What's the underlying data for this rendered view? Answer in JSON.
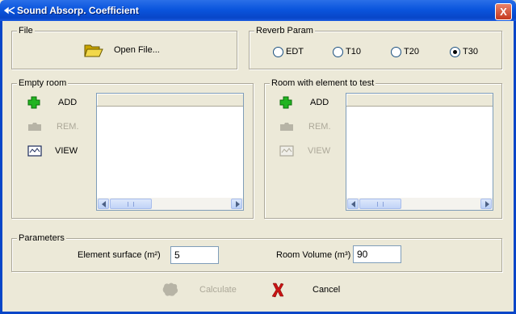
{
  "window": {
    "title": "Sound Absorp. Coefficient",
    "close_label": "X"
  },
  "file_group": {
    "label": "File",
    "open_label": "Open File..."
  },
  "reverb": {
    "label": "Reverb Param",
    "options": [
      {
        "label": "EDT",
        "checked": false
      },
      {
        "label": "T10",
        "checked": false
      },
      {
        "label": "T20",
        "checked": false
      },
      {
        "label": "T30",
        "checked": true
      }
    ]
  },
  "empty_room": {
    "label": "Empty room",
    "add": "ADD",
    "remove": "REM.",
    "view": "VIEW"
  },
  "test_room": {
    "label": "Room with element to test",
    "add": "ADD",
    "remove": "REM.",
    "view": "VIEW"
  },
  "parameters": {
    "label": "Parameters",
    "surface_label": "Element surface (m²)",
    "surface_value": "5",
    "volume_label": "Room Volume (m³)",
    "volume_value": "90"
  },
  "actions": {
    "calculate": "Calculate",
    "cancel": "Cancel"
  },
  "colors": {
    "titlebar": "#0a55dd",
    "add_icon": "#21b421",
    "cancel_icon": "#c81414",
    "window_bg": "#ece9d8"
  }
}
